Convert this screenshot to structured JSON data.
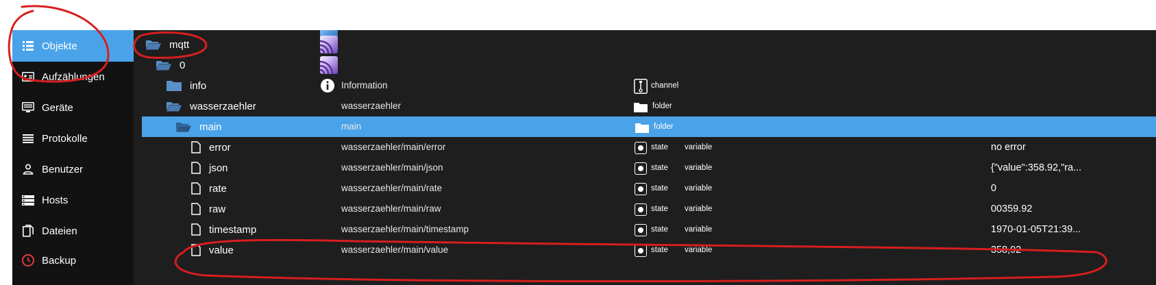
{
  "sidebar": {
    "items": [
      {
        "label": "Objekte",
        "icon": "list-icon"
      },
      {
        "label": "Aufzählungen",
        "icon": "enum-icon"
      },
      {
        "label": "Geräte",
        "icon": "device-icon"
      },
      {
        "label": "Protokolle",
        "icon": "log-icon"
      },
      {
        "label": "Benutzer",
        "icon": "user-icon"
      },
      {
        "label": "Hosts",
        "icon": "hosts-icon"
      },
      {
        "label": "Dateien",
        "icon": "files-icon"
      },
      {
        "label": "Backup",
        "icon": "backup-icon"
      }
    ]
  },
  "tree": {
    "rows": [
      {
        "name": "mqtt",
        "desc": "",
        "type": "",
        "role": "",
        "value": ""
      },
      {
        "name": "0",
        "desc": "",
        "type": "",
        "role": "",
        "value": ""
      },
      {
        "name": "info",
        "desc": "Information",
        "type": "channel",
        "role": "",
        "value": ""
      },
      {
        "name": "wasserzaehler",
        "desc": "wasserzaehler",
        "type": "folder",
        "role": "",
        "value": ""
      },
      {
        "name": "main",
        "desc": "main",
        "type": "folder",
        "role": "",
        "value": ""
      },
      {
        "name": "error",
        "desc": "wasserzaehler/main/error",
        "type": "state",
        "role": "variable",
        "value": "no error"
      },
      {
        "name": "json",
        "desc": "wasserzaehler/main/json",
        "type": "state",
        "role": "variable",
        "value": "{\"value\":358.92,\"ra..."
      },
      {
        "name": "rate",
        "desc": "wasserzaehler/main/rate",
        "type": "state",
        "role": "variable",
        "value": "0"
      },
      {
        "name": "raw",
        "desc": "wasserzaehler/main/raw",
        "type": "state",
        "role": "variable",
        "value": "00359.92"
      },
      {
        "name": "timestamp",
        "desc": "wasserzaehler/main/timestamp",
        "type": "state",
        "role": "variable",
        "value": "1970-01-05T21:39..."
      },
      {
        "name": "value",
        "desc": "wasserzaehler/main/value",
        "type": "state",
        "role": "variable",
        "value": "358,92"
      }
    ]
  },
  "colors": {
    "accent": "#4aa3e8",
    "sidebar_bg": "#121212",
    "panel_bg": "#1e1e1e",
    "folder": "#5b8fc7",
    "annotation": "#d81e1e"
  }
}
